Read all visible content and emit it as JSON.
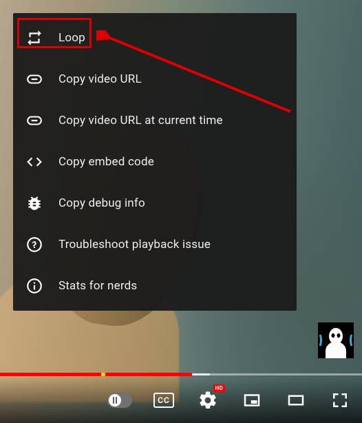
{
  "context_menu": {
    "items": [
      {
        "icon": "loop-icon",
        "label": "Loop"
      },
      {
        "icon": "link-icon",
        "label": "Copy video URL"
      },
      {
        "icon": "link-icon",
        "label": "Copy video URL at current time"
      },
      {
        "icon": "embed-icon",
        "label": "Copy embed code"
      },
      {
        "icon": "bug-icon",
        "label": "Copy debug info"
      },
      {
        "icon": "help-icon",
        "label": "Troubleshoot playback issue"
      },
      {
        "icon": "info-icon",
        "label": "Stats for nerds"
      }
    ]
  },
  "controls": {
    "cc_label": "CC",
    "hd_badge": "HD"
  },
  "progress": {
    "played_pct": 53,
    "buffered_start_pct": 53,
    "buffered_end_pct": 58,
    "ad_marker_pct": 28
  }
}
